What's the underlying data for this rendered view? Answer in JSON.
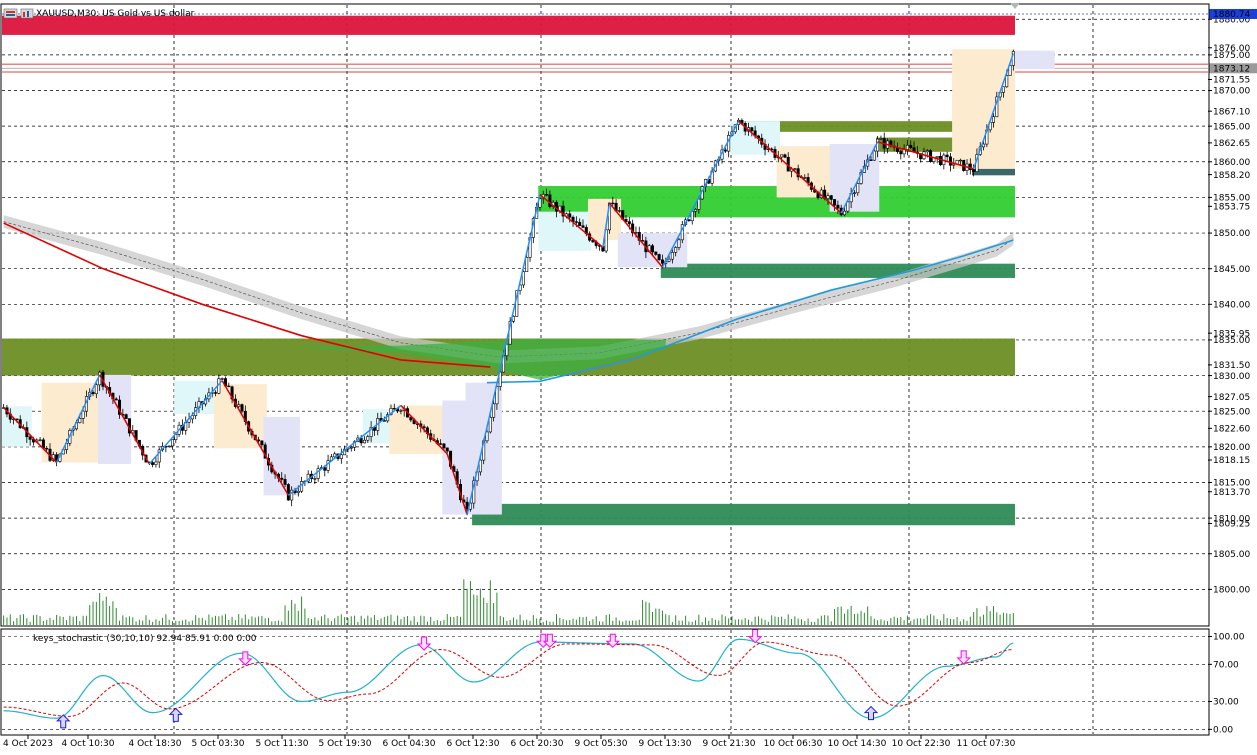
{
  "chart_title": "XAUUSD,M30:  US Gold vs US dollar",
  "chart_data": [
    {
      "type": "candlestick",
      "symbol": "XAUUSD",
      "timeframe": "M30",
      "description": "US Gold vs US dollar",
      "ylim": [
        1795.0,
        1882.0
      ],
      "y_ticks": [
        {
          "label": "1880.00",
          "value": 1880.0
        },
        {
          "label": "1876.00",
          "value": 1876.0
        },
        {
          "label": "1875.00",
          "value": 1875.0
        },
        {
          "label": "1871.55",
          "value": 1871.55
        },
        {
          "label": "1870.00",
          "value": 1870.0
        },
        {
          "label": "1867.10",
          "value": 1867.1
        },
        {
          "label": "1865.00",
          "value": 1865.0
        },
        {
          "label": "1862.65",
          "value": 1862.65
        },
        {
          "label": "1860.00",
          "value": 1860.0
        },
        {
          "label": "1858.20",
          "value": 1858.2
        },
        {
          "label": "1855.00",
          "value": 1855.0
        },
        {
          "label": "1853.75",
          "value": 1853.75
        },
        {
          "label": "1850.00",
          "value": 1850.0
        },
        {
          "label": "1845.00",
          "value": 1845.0
        },
        {
          "label": "1840.00",
          "value": 1840.0
        },
        {
          "label": "1835.95",
          "value": 1835.95
        },
        {
          "label": "1835.00",
          "value": 1835.0
        },
        {
          "label": "1831.50",
          "value": 1831.5
        },
        {
          "label": "1830.00",
          "value": 1830.0
        },
        {
          "label": "1827.05",
          "value": 1827.05
        },
        {
          "label": "1825.00",
          "value": 1825.0
        },
        {
          "label": "1822.60",
          "value": 1822.6
        },
        {
          "label": "1820.00",
          "value": 1820.0
        },
        {
          "label": "1818.15",
          "value": 1818.15
        },
        {
          "label": "1815.00",
          "value": 1815.0
        },
        {
          "label": "1813.70",
          "value": 1813.7
        },
        {
          "label": "1810.00",
          "value": 1810.0
        },
        {
          "label": "1809.25",
          "value": 1809.25
        },
        {
          "label": "1805.00",
          "value": 1805.0
        },
        {
          "label": "1800.00",
          "value": 1800.0
        }
      ],
      "price_tags": [
        {
          "label": "1880.74",
          "value": 1880.74,
          "color": "#1a3fd6"
        },
        {
          "label": "1873.12",
          "value": 1873.12,
          "color": "#9a9a9a"
        }
      ],
      "x_tick_labels": [
        "4 Oct 2023",
        "4 Oct 10:30",
        "4 Oct 18:30",
        "5 Oct 03:30",
        "5 Oct 11:30",
        "5 Oct 19:30",
        "6 Oct 04:30",
        "6 Oct 12:30",
        "6 Oct 20:30",
        "9 Oct 05:30",
        "9 Oct 13:30",
        "9 Oct 21:30",
        "10 Oct 06:30",
        "10 Oct 14:30",
        "10 Oct 22:30",
        "11 Oct 07:30"
      ],
      "swing_points": [
        {
          "bar": 0,
          "price": 1825.5
        },
        {
          "bar": 16,
          "price": 1817.8
        },
        {
          "bar": 29,
          "price": 1830.1
        },
        {
          "bar": 44,
          "price": 1817.6
        },
        {
          "bar": 66,
          "price": 1829.3
        },
        {
          "bar": 86,
          "price": 1813.2
        },
        {
          "bar": 120,
          "price": 1825.8
        },
        {
          "bar": 134,
          "price": 1819.0
        },
        {
          "bar": 140,
          "price": 1810.5
        },
        {
          "bar": 162,
          "price": 1855.4
        },
        {
          "bar": 181,
          "price": 1848.0
        },
        {
          "bar": 183,
          "price": 1854.2
        },
        {
          "bar": 199,
          "price": 1845.2
        },
        {
          "bar": 222,
          "price": 1865.7
        },
        {
          "bar": 253,
          "price": 1852.8
        },
        {
          "bar": 264,
          "price": 1862.8
        },
        {
          "bar": 293,
          "price": 1859.0
        },
        {
          "bar": 305,
          "price": 1875.2
        }
      ],
      "moving_averages": [
        {
          "name": "red MA",
          "color": "#e00000",
          "points": [
            [
              0,
              1851.4
            ],
            [
              30,
              1845.0
            ],
            [
              60,
              1840.0
            ],
            [
              90,
              1835.6
            ],
            [
              120,
              1832.2
            ],
            [
              147,
              1831.2
            ]
          ]
        },
        {
          "name": "blue MA",
          "color": "#1e9be0",
          "points": [
            [
              146,
              1829.0
            ],
            [
              162,
              1829.2
            ],
            [
              190,
              1832.3
            ],
            [
              222,
              1838.0
            ],
            [
              250,
              1842.0
            ],
            [
              275,
              1844.8
            ],
            [
              290,
              1846.8
            ],
            [
              305,
              1849.0
            ]
          ]
        }
      ],
      "supply_demand_zones": [
        {
          "from_bar": 0,
          "to_bar": 305,
          "top": 1880.5,
          "bottom": 1877.8,
          "color": "#dc143c"
        },
        {
          "from_bar": 0,
          "to_bar": 305,
          "top": 1835.2,
          "bottom": 1830.0,
          "color": "#6b8e23"
        },
        {
          "from_bar": 142,
          "to_bar": 305,
          "top": 1812.0,
          "bottom": 1809.0,
          "color": "#2e8b57"
        },
        {
          "from_bar": 162,
          "to_bar": 305,
          "top": 1856.6,
          "bottom": 1852.2,
          "color": "#32cd32"
        },
        {
          "from_bar": 199,
          "to_bar": 305,
          "top": 1845.7,
          "bottom": 1843.7,
          "color": "#2e8b57"
        },
        {
          "from_bar": 222,
          "to_bar": 305,
          "top": 1865.7,
          "bottom": 1864.2,
          "color": "#6b8e23"
        },
        {
          "from_bar": 264,
          "to_bar": 305,
          "top": 1863.4,
          "bottom": 1861.4,
          "color": "#6b8e23"
        },
        {
          "from_bar": 293,
          "to_bar": 305,
          "top": 1859.4,
          "bottom": 1858.1,
          "color": "#2f5f5f"
        }
      ]
    },
    {
      "type": "line",
      "name": "keys_stochastic (30,10,10) 92.94 85.91 0.00 0.00",
      "ylim": [
        -5,
        107
      ],
      "y_ticks": [
        {
          "label": "100.00",
          "value": 100
        },
        {
          "label": "70.00",
          "value": 70
        },
        {
          "label": "30.00",
          "value": 30
        },
        {
          "label": "0.00",
          "value": 0
        }
      ],
      "main_line": [
        [
          0,
          20
        ],
        [
          16,
          12
        ],
        [
          30,
          58
        ],
        [
          45,
          18
        ],
        [
          72,
          82
        ],
        [
          90,
          30
        ],
        [
          104,
          40
        ],
        [
          126,
          91
        ],
        [
          142,
          51
        ],
        [
          162,
          94
        ],
        [
          190,
          92
        ],
        [
          210,
          52
        ],
        [
          222,
          97
        ],
        [
          240,
          82
        ],
        [
          262,
          12
        ],
        [
          285,
          68
        ],
        [
          300,
          78
        ],
        [
          305,
          93
        ]
      ],
      "signal_line": [
        [
          0,
          24
        ],
        [
          20,
          14
        ],
        [
          36,
          50
        ],
        [
          50,
          22
        ],
        [
          78,
          72
        ],
        [
          98,
          31
        ],
        [
          110,
          38
        ],
        [
          132,
          86
        ],
        [
          150,
          56
        ],
        [
          170,
          92
        ],
        [
          196,
          91
        ],
        [
          216,
          58
        ],
        [
          230,
          94
        ],
        [
          250,
          80
        ],
        [
          270,
          25
        ],
        [
          292,
          72
        ],
        [
          305,
          86
        ]
      ],
      "up_arrows": [
        [
          18,
          8
        ],
        [
          52,
          15
        ],
        [
          262,
          17
        ]
      ],
      "down_arrows": [
        [
          73,
          77
        ],
        [
          127,
          93
        ],
        [
          163,
          96
        ],
        [
          165,
          96
        ],
        [
          184,
          96
        ],
        [
          227,
          101
        ],
        [
          290,
          78
        ]
      ]
    }
  ]
}
